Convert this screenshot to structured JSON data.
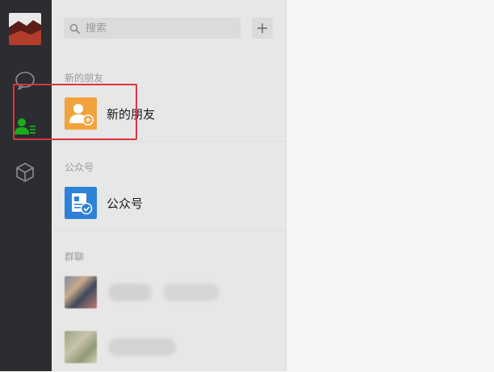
{
  "sidebar": {
    "icons": [
      "avatar",
      "chat-icon",
      "contacts-icon",
      "box-icon"
    ]
  },
  "search": {
    "placeholder": "搜索"
  },
  "sections": {
    "new_friends_title": "新的朋友",
    "new_friends_item": "新的朋友",
    "official_title": "公众号",
    "official_item": "公众号",
    "groups_title": "群聊"
  },
  "colors": {
    "accent_green": "#1aad19",
    "highlight_red": "#d9363e",
    "new_friend_orange": "#f3a33b",
    "official_blue": "#2d82d8"
  }
}
